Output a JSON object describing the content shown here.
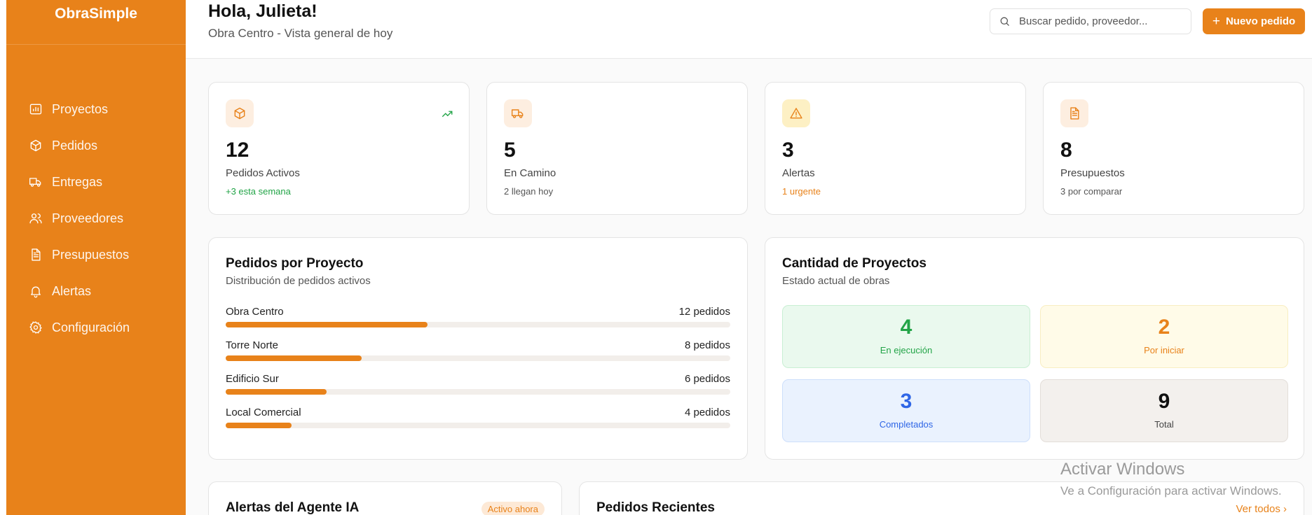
{
  "app": {
    "brand": "ObraSimple"
  },
  "sidebar": {
    "items": [
      {
        "label": "Proyectos",
        "icon": "chart-icon"
      },
      {
        "label": "Pedidos",
        "icon": "package-icon"
      },
      {
        "label": "Entregas",
        "icon": "truck-icon"
      },
      {
        "label": "Proveedores",
        "icon": "users-icon"
      },
      {
        "label": "Presupuestos",
        "icon": "document-icon"
      },
      {
        "label": "Alertas",
        "icon": "bell-icon"
      },
      {
        "label": "Configuración",
        "icon": "gear-icon"
      }
    ]
  },
  "header": {
    "greeting": "Hola, Julieta!",
    "subtitle": "Obra Centro - Vista general de hoy",
    "search_placeholder": "Buscar pedido, proveedor...",
    "new_button": "Nuevo pedido"
  },
  "stats": [
    {
      "value": "12",
      "label": "Pedidos Activos",
      "note": "+3 esta semana",
      "icon": "package-icon",
      "note_color": "#22a447",
      "icon_bg": "#fdeee0",
      "icon_color": "#e8821a"
    },
    {
      "value": "5",
      "label": "En Camino",
      "note": "2 llegan hoy",
      "icon": "truck-icon",
      "note_color": "#555555",
      "icon_bg": "#fdeee0",
      "icon_color": "#e8821a"
    },
    {
      "value": "3",
      "label": "Alertas",
      "note": "1 urgente",
      "icon": "alert-triangle-icon",
      "note_color": "#e8821a",
      "icon_bg": "#fdf0c4",
      "icon_color": "#e8821a"
    },
    {
      "value": "8",
      "label": "Presupuestos",
      "note": "3 por comparar",
      "icon": "document-icon",
      "note_color": "#555555",
      "icon_bg": "#fdeee0",
      "icon_color": "#e8821a"
    }
  ],
  "orders_by_project": {
    "title": "Pedidos por Proyecto",
    "subtitle": "Distribución de pedidos activos",
    "rows": [
      {
        "name": "Obra Centro",
        "count_label": "12 pedidos",
        "fill": 0.4
      },
      {
        "name": "Torre Norte",
        "count_label": "8 pedidos",
        "fill": 0.27
      },
      {
        "name": "Edificio Sur",
        "count_label": "6 pedidos",
        "fill": 0.2
      },
      {
        "name": "Local Comercial",
        "count_label": "4 pedidos",
        "fill": 0.13
      }
    ]
  },
  "project_count": {
    "title": "Cantidad de Proyectos",
    "subtitle": "Estado actual de obras",
    "tiles": [
      {
        "value": "4",
        "label": "En ejecución",
        "bg": "#eaf9ee",
        "border": "#c9efd3",
        "num_color": "#22a447",
        "label_color": "#22a447"
      },
      {
        "value": "2",
        "label": "Por iniciar",
        "bg": "#fffbe8",
        "border": "#f8eec2",
        "num_color": "#e8821a",
        "label_color": "#e8821a"
      },
      {
        "value": "3",
        "label": "Completados",
        "bg": "#eaf2fe",
        "border": "#cddffb",
        "num_color": "#2f66e6",
        "label_color": "#2f66e6"
      },
      {
        "value": "9",
        "label": "Total",
        "bg": "#f3f0ed",
        "border": "#e3ded9",
        "num_color": "#111111",
        "label_color": "#444444"
      }
    ]
  },
  "agent_alerts": {
    "title": "Alertas del Agente IA",
    "badge": "Activo ahora"
  },
  "recent_orders": {
    "title": "Pedidos Recientes",
    "link": "Ver todos"
  },
  "watermark": {
    "line1": "Activar Windows",
    "line2": "Ve a Configuración para activar Windows."
  }
}
